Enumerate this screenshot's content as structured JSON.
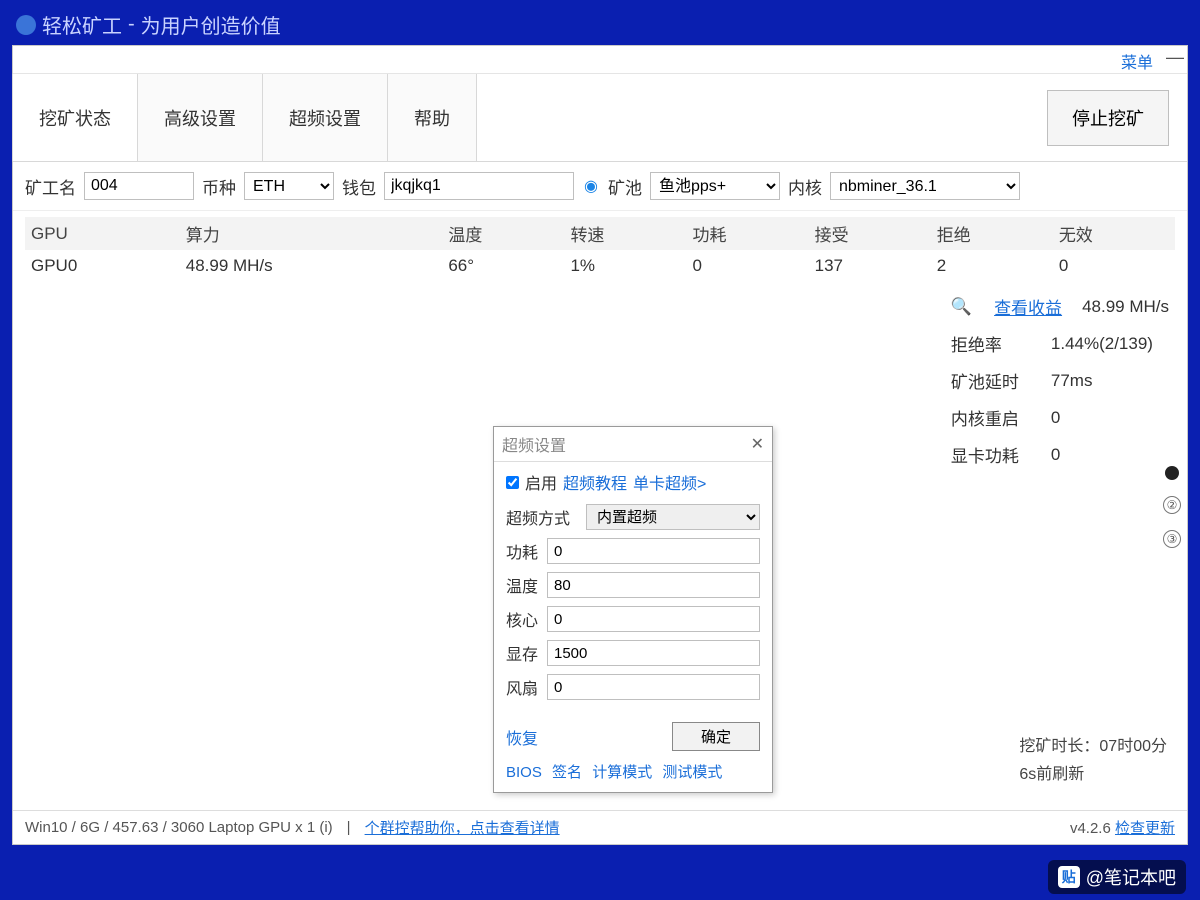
{
  "title_app": "轻松矿工",
  "title_slogan": "为用户创造价值",
  "menu_label": "菜单",
  "tabs": {
    "status": "挖矿状态",
    "advanced": "高级设置",
    "overclock": "超频设置",
    "help": "帮助"
  },
  "stop_button": "停止挖矿",
  "config_labels": {
    "miner_name": "矿工名",
    "coin": "币种",
    "wallet": "钱包",
    "pool": "矿池",
    "core": "内核"
  },
  "config_values": {
    "miner_name": "004",
    "coin": "ETH",
    "wallet": "jkqjkq1",
    "pool": "鱼池pps+",
    "core": "nbminer_36.1"
  },
  "gpu_headers": {
    "gpu": "GPU",
    "hash": "算力",
    "temp": "温度",
    "fan": "转速",
    "power": "功耗",
    "accept": "接受",
    "reject": "拒绝",
    "invalid": "无效"
  },
  "gpu_row": {
    "gpu": "GPU0",
    "hash": "48.99 MH/s",
    "temp": "66°",
    "fan": "1%",
    "power": "0",
    "accept": "137",
    "reject": "2",
    "invalid": "0"
  },
  "stats": {
    "view_profit": "查看收益",
    "total_hash": "48.99 MH/s",
    "reject_rate_label": "拒绝率",
    "reject_rate": "1.44%(2/139)",
    "pool_latency_label": "矿池延时",
    "pool_latency": "77ms",
    "core_restart_label": "内核重启",
    "core_restart": "0",
    "gpu_power_label": "显卡功耗",
    "gpu_power": "0"
  },
  "side_badges": [
    "②",
    "③"
  ],
  "dialog": {
    "title": "超频设置",
    "enable_label": "启用",
    "tutorial_link": "超频教程",
    "single_card_link": "单卡超频>",
    "mode_label": "超频方式",
    "mode_value": "内置超频",
    "power_label": "功耗",
    "power_value": "0",
    "temp_label": "温度",
    "temp_value": "80",
    "core_label": "核心",
    "core_value": "0",
    "mem_label": "显存",
    "mem_value": "1500",
    "fan_label": "风扇",
    "fan_value": "0",
    "restore": "恢复",
    "ok": "确定",
    "foot_links": {
      "bios": "BIOS",
      "sign": "签名",
      "calc_mode": "计算模式",
      "test_mode": "测试模式"
    }
  },
  "runtime": {
    "duration_label": "挖矿时长：",
    "duration_value": "07时00分",
    "refresh": "6s前刷新"
  },
  "statusbar": {
    "sysinfo": "Win10  / 6G / 457.63 / 3060 Laptop GPU x 1 (i)",
    "group_help": "个群控帮助你，点击查看详情",
    "version": "v4.2.6",
    "update": "检查更新"
  },
  "watermark": "@笔记本吧"
}
